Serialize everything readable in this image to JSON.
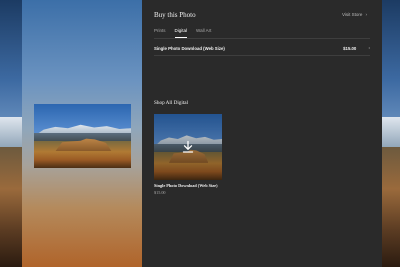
{
  "header": {
    "title": "Buy this Photo",
    "visit_store_label": "Visit Store",
    "visit_store_icon": "chevron-right-icon"
  },
  "tabs": [
    {
      "label": "Prints",
      "active": false
    },
    {
      "label": "Digital",
      "active": true
    },
    {
      "label": "Wall Art",
      "active": false
    }
  ],
  "product": {
    "name": "Single Photo Download (Web Size)",
    "price": "$15.00",
    "icon": "chevron-right-icon"
  },
  "shop_section": {
    "heading": "Shop All Digital",
    "cards": [
      {
        "name": "Single Photo Download (Web Size)",
        "price": "$15.00",
        "icon": "download-icon"
      }
    ]
  }
}
